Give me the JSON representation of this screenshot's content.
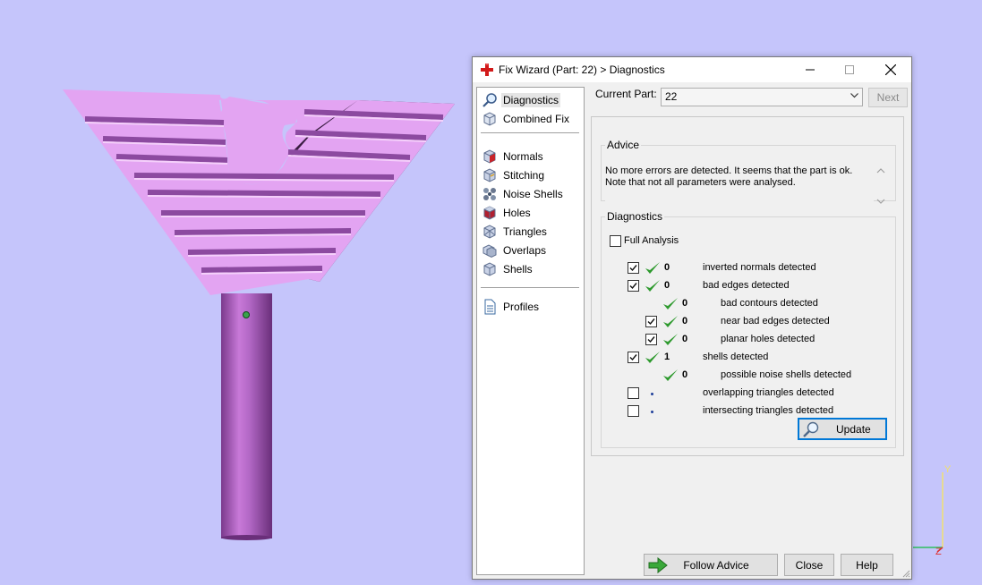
{
  "viewport": {
    "background": "#c5c5fb",
    "model_color": "#e3a4f2",
    "groove_color": "#8c4aa0",
    "axes": {
      "y_label": "Y",
      "z_label": "Z"
    }
  },
  "dialog": {
    "title": "Fix Wizard (Part: 22) > Diagnostics",
    "app_icon": "red-cross-icon",
    "window_buttons": {
      "minimize": "minimize-icon",
      "maximize": "maximize-icon",
      "close": "close-icon"
    }
  },
  "nav": {
    "items": [
      {
        "label": "Diagnostics",
        "icon": "magnifier-icon",
        "selected": true
      },
      {
        "label": "Combined Fix",
        "icon": "cube-wire-icon"
      },
      {
        "label": "Normals",
        "icon": "cube-red-face-icon"
      },
      {
        "label": "Stitching",
        "icon": "cube-stitch-icon"
      },
      {
        "label": "Noise Shells",
        "icon": "noise-shells-icon"
      },
      {
        "label": "Holes",
        "icon": "cube-holes-icon"
      },
      {
        "label": "Triangles",
        "icon": "triangles-icon"
      },
      {
        "label": "Overlaps",
        "icon": "overlaps-icon"
      },
      {
        "label": "Shells",
        "icon": "shells-icon"
      },
      {
        "label": "Profiles",
        "icon": "document-icon"
      }
    ]
  },
  "part": {
    "label": "Current Part:",
    "value": "22",
    "next_label": "Next"
  },
  "advice": {
    "legend": "Advice",
    "line1": "No more errors are detected. It seems that the part is ok.",
    "line2": "Note that not all parameters were analysed."
  },
  "diagnostics": {
    "legend": "Diagnostics",
    "full_analysis_label": "Full Analysis",
    "full_analysis_checked": false,
    "rows": [
      {
        "label": "inverted normals detected",
        "count": "0",
        "checked": true,
        "has_checkbox": true,
        "status": "ok"
      },
      {
        "label": "bad edges detected",
        "count": "0",
        "checked": true,
        "has_checkbox": true,
        "status": "ok"
      },
      {
        "label": "bad contours detected",
        "count": "0",
        "has_checkbox": false,
        "status": "ok"
      },
      {
        "label": "near bad edges detected",
        "count": "0",
        "checked": true,
        "has_checkbox": true,
        "status": "ok"
      },
      {
        "label": "planar holes detected",
        "count": "0",
        "checked": true,
        "has_checkbox": true,
        "status": "ok"
      },
      {
        "label": "shells detected",
        "count": "1",
        "checked": true,
        "has_checkbox": true,
        "status": "ok"
      },
      {
        "label": "possible noise shells detected",
        "count": "0",
        "has_checkbox": false,
        "status": "ok"
      },
      {
        "label": "overlapping triangles detected",
        "count": "",
        "checked": false,
        "has_checkbox": true,
        "status": "not-analysed"
      },
      {
        "label": "intersecting triangles detected",
        "count": "",
        "checked": false,
        "has_checkbox": true,
        "status": "not-analysed"
      }
    ],
    "update_label": "Update"
  },
  "footer": {
    "follow_label": "Follow Advice",
    "close_label": "Close",
    "help_label": "Help"
  },
  "colors": {
    "check_green": "#2e9a2e",
    "accent_blue": "#0078d7"
  }
}
